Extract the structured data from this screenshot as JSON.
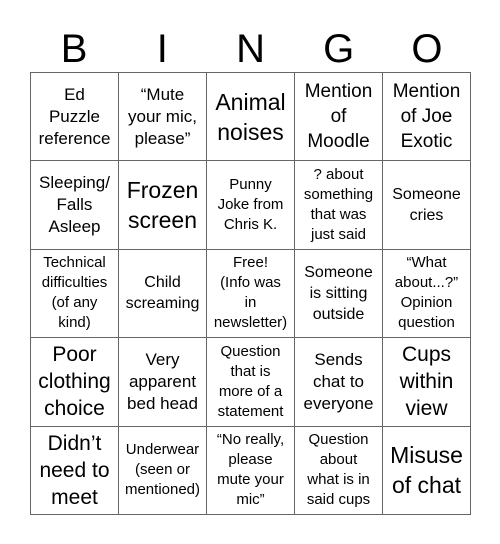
{
  "header": [
    "B",
    "I",
    "N",
    "G",
    "O"
  ],
  "cells": [
    {
      "text": "Ed\nPuzzle\nreference",
      "size": "s17"
    },
    {
      "text": "“Mute\nyour mic,\nplease”",
      "size": "s17"
    },
    {
      "text": "Animal\nnoises",
      "size": "s23"
    },
    {
      "text": "Mention\nof\nMoodle",
      "size": "s19"
    },
    {
      "text": "Mention\nof Joe\nExotic",
      "size": "s19"
    },
    {
      "text": "Sleeping/\nFalls\nAsleep",
      "size": "s17"
    },
    {
      "text": "Frozen\nscreen",
      "size": "s23"
    },
    {
      "text": "Punny\nJoke from\nChris K.",
      "size": "s15"
    },
    {
      "text": "? about\nsomething\nthat was\njust said",
      "size": "s15"
    },
    {
      "text": "Someone\ncries",
      "size": "s16"
    },
    {
      "text": "Technical\ndifficulties\n(of any\nkind)",
      "size": "s15"
    },
    {
      "text": "Child\nscreaming",
      "size": "s16"
    },
    {
      "text": "Free!\n(Info was\nin\nnewsletter)",
      "size": "s15"
    },
    {
      "text": "Someone\nis sitting\noutside",
      "size": "s16"
    },
    {
      "text": "“What\nabout...?”\nOpinion\nquestion",
      "size": "s15"
    },
    {
      "text": "Poor\nclothing\nchoice",
      "size": "s21"
    },
    {
      "text": "Very\napparent\nbed head",
      "size": "s17"
    },
    {
      "text": "Question\nthat is\nmore of a\nstatement",
      "size": "s15"
    },
    {
      "text": "Sends\nchat to\neveryone",
      "size": "s17"
    },
    {
      "text": "Cups\nwithin\nview",
      "size": "s21"
    },
    {
      "text": "Didn’t\nneed to\nmeet",
      "size": "s21"
    },
    {
      "text": "Underwear\n(seen or\nmentioned)",
      "size": "s15"
    },
    {
      "text": "“No really,\nplease\nmute your\nmic”",
      "size": "s15"
    },
    {
      "text": "Question\nabout\nwhat is in\nsaid cups",
      "size": "s15"
    },
    {
      "text": "Misuse\nof chat",
      "size": "s23"
    }
  ]
}
